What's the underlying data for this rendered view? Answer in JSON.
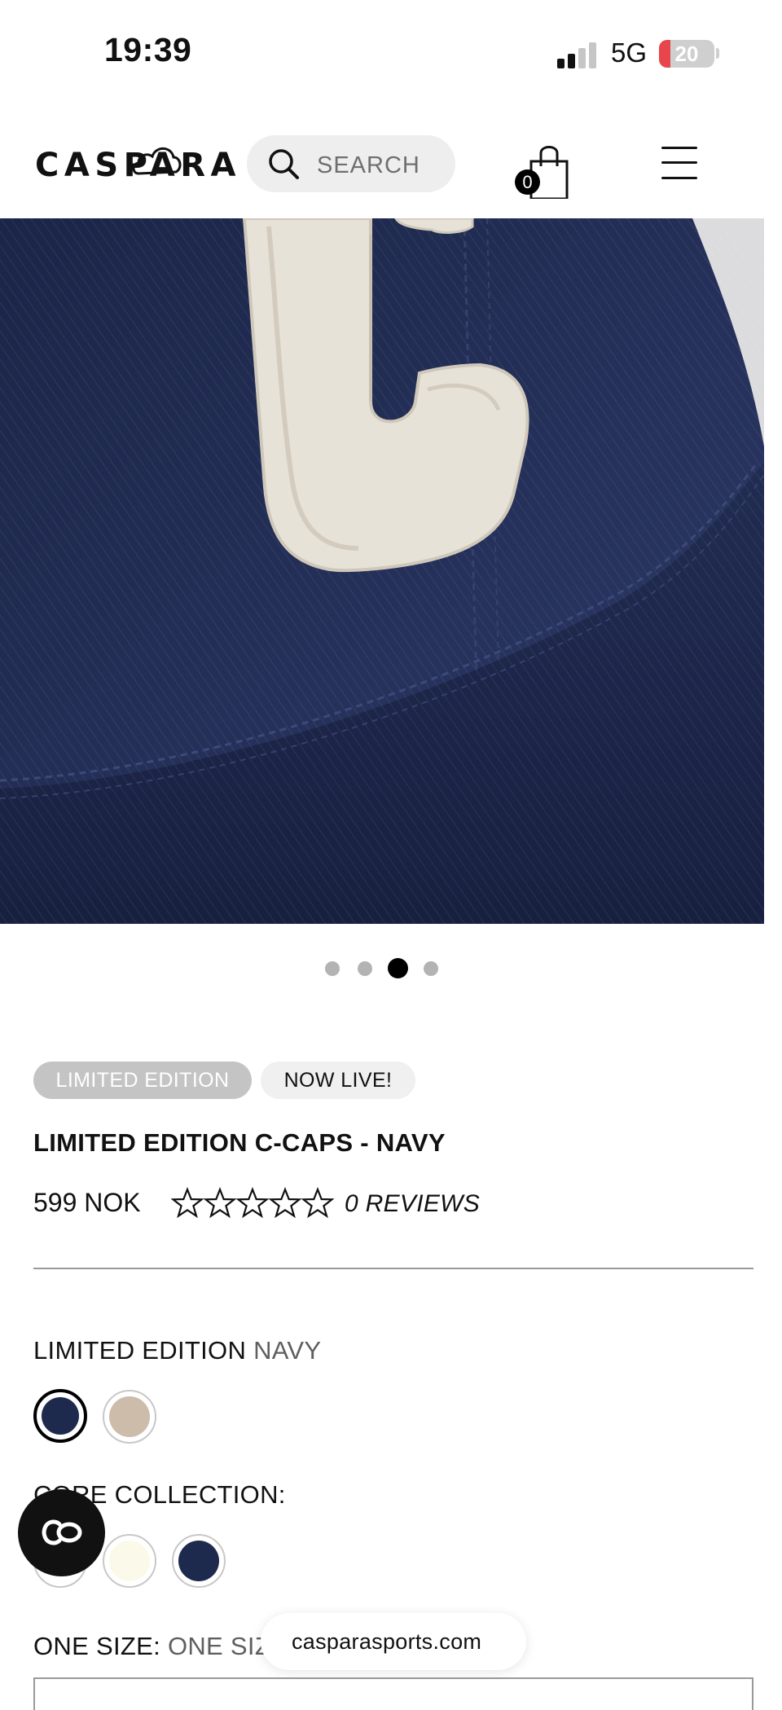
{
  "status_bar": {
    "time": "19:39",
    "network": "5G",
    "battery": "20",
    "battery_level": 0.2,
    "signal_bars": 2,
    "signal_bars_total": 4
  },
  "header": {
    "logo": "CASPARA",
    "search_placeholder": "SEARCH",
    "cart_count": "0",
    "icons": [
      "search-icon",
      "shopping-bag-icon",
      "hamburger-menu-icon"
    ]
  },
  "gallery": {
    "slide_count": 4,
    "active_slide": 3
  },
  "product": {
    "badges": [
      "LIMITED EDITION",
      "NOW LIVE!"
    ],
    "title": "LIMITED EDITION C-CAPS - NAVY",
    "price": "599 NOK",
    "rating": 0,
    "rating_max": 5,
    "reviews": "0 REVIEWS"
  },
  "limited_edition": {
    "label": "LIMITED EDITION",
    "selected_color": "NAVY",
    "swatches": [
      {
        "color": "#1d2a4d",
        "selected": true
      },
      {
        "color": "#cdbcaa",
        "selected": false
      }
    ]
  },
  "core_collection": {
    "label": "CORE COLLECTION:",
    "swatches": [
      {
        "color": "#ffffff",
        "selected": false
      },
      {
        "color": "#fbfaea",
        "selected": false
      },
      {
        "color": "#1d2a4d",
        "selected": false
      }
    ]
  },
  "size": {
    "label": "ONE SIZE:",
    "value": "ONE SIZE"
  },
  "browser": {
    "url": "casparasports.com"
  },
  "colors": {
    "navy": "#1d2a4d",
    "badge_grey": "#c4c4c4",
    "battery_red": "#e8454c"
  }
}
